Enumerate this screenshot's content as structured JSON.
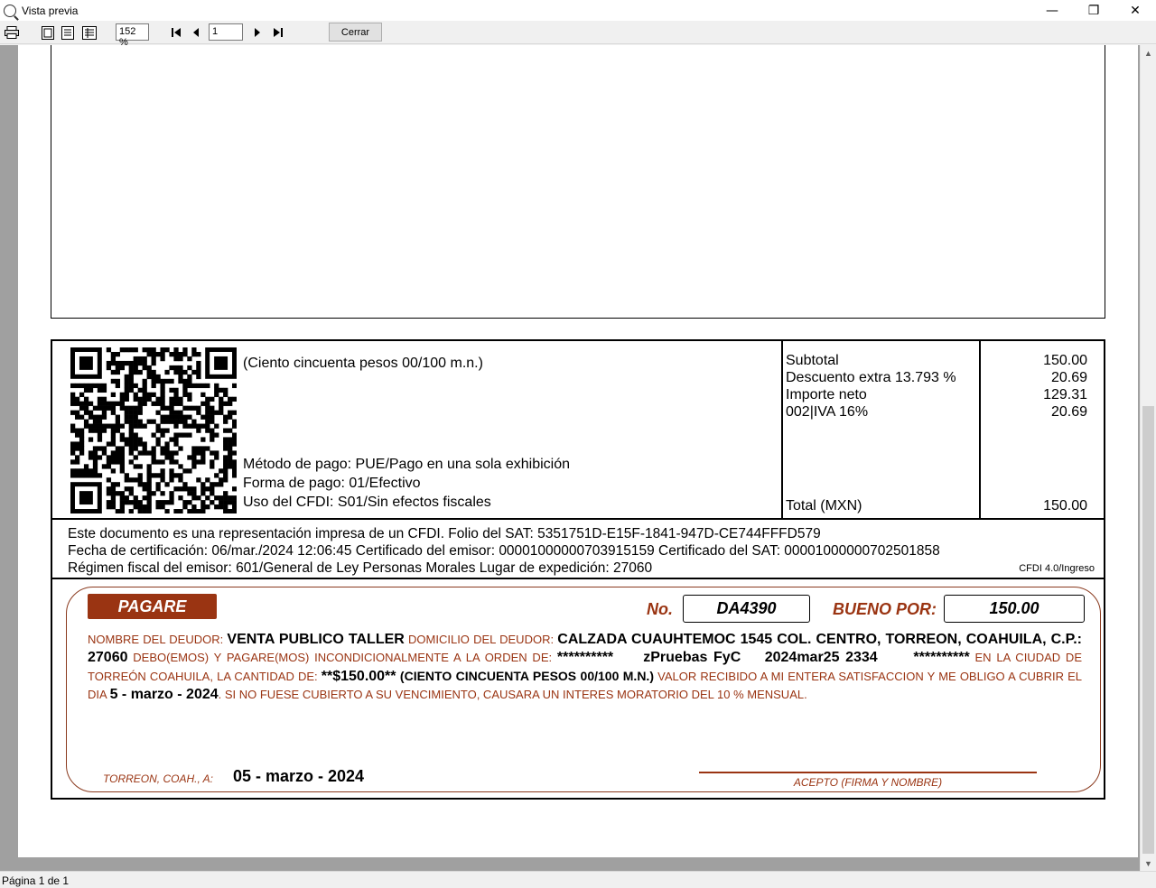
{
  "window": {
    "title": "Vista previa",
    "minimize": "—",
    "maximize": "❐",
    "close": "✕"
  },
  "toolbar": {
    "zoom": "152 %",
    "page": "1",
    "close_label": "Cerrar"
  },
  "status": "Página 1 de 1",
  "invoice": {
    "amount_words": "(Ciento cincuenta pesos 00/100 m.n.)",
    "metodo_pago": "Método de pago: PUE/Pago en una sola exhibición",
    "forma_pago": "Forma de pago: 01/Efectivo",
    "uso_cfdi": "Uso del CFDI: S01/Sin efectos fiscales",
    "totals": [
      {
        "label": "Subtotal",
        "value": "150.00"
      },
      {
        "label": "Descuento extra 13.793 %",
        "value": "20.69"
      },
      {
        "label": "Importe neto",
        "value": "129.31"
      },
      {
        "label": "002|IVA 16%",
        "value": "20.69"
      }
    ],
    "total_label": "Total (MXN)",
    "total_value": "150.00",
    "cert_line1": "Este documento es una representación impresa de un CFDI.  Folio del SAT: 5351751D-E15F-1841-947D-CE744FFFD579",
    "cert_line2": "Fecha de certificación: 06/mar./2024 12:06:45  Certificado del emisor: 00001000000703915159  Certificado del SAT: 00001000000702501858",
    "cert_line3": "Régimen fiscal del emisor: 601/General de Ley Personas Morales  Lugar de expedición: 27060",
    "cfdi_version": "CFDI 4.0/Ingreso"
  },
  "pagare": {
    "title": "PAGARE",
    "no_label": "No.",
    "no_value": "DA4390",
    "bueno_label": "BUENO POR:",
    "bueno_value": "150.00",
    "t1": "NOMBRE DEL DEUDOR: ",
    "deudor": "VENTA PUBLICO TALLER",
    "t2": " DOMICILIO DEL DEUDOR: ",
    "domicilio": "CALZADA CUAUHTEMOC 1545  COL. CENTRO, TORREON, COAHUILA, C.P.: 27060",
    "t3": " DEBO(EMOS) Y PAGARE(MOS) INCONDICIONALMENTE A LA ORDEN DE: ",
    "orden": "**********     zPruebas FyC    2024mar25 2334      **********",
    "t4": " EN LA CIUDAD DE TORREÓN   COAHUILA, LA CANTIDAD DE: ",
    "cantidad": "**$150.00**",
    "cantidad_letra": " (CIENTO CINCUENTA PESOS 00/100 M.N.)",
    "t5": " VALOR RECIBIDO A MI ENTERA SATISFACCION Y ME OBLIGO A CUBRIR EL DIA ",
    "vencimiento": "5 - marzo - 2024",
    "t6": ". SI NO FUESE CUBIERTO A SU VENCIMIENTO, CAUSARA UN INTERES MORATORIO DEL 10 % MENSUAL.",
    "lugar": "TORREON, COAH., A:",
    "fecha": "05 - marzo - 2024",
    "firma": "ACEPTO (FIRMA Y NOMBRE)"
  },
  "colors": {
    "pagare_accent": "#9a3412"
  },
  "icons": [
    "print-icon",
    "one-page-icon",
    "two-page-icon",
    "thumbnails-icon",
    "first-page-icon",
    "prev-page-icon",
    "next-page-icon",
    "last-page-icon"
  ]
}
